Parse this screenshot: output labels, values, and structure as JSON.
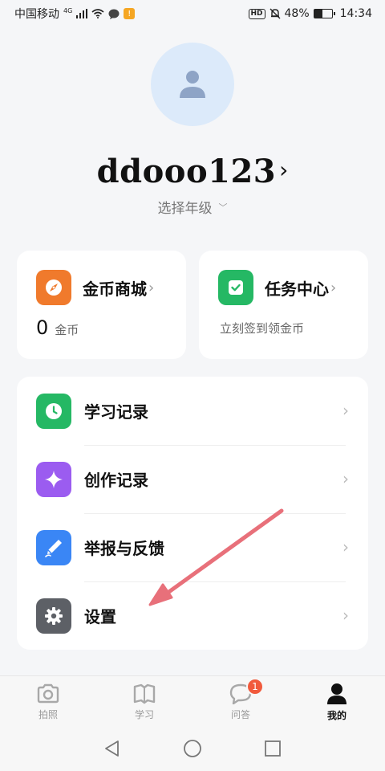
{
  "status_bar": {
    "carrier": "中国移动",
    "network": "4G",
    "battery": "48%",
    "battery_level": 0.48,
    "time": "14:34",
    "hd_label": "HD"
  },
  "profile": {
    "username": "ddooo123",
    "username_chevron": "›",
    "grade_select": "选择年级",
    "grade_chevron": "﹀"
  },
  "cards": {
    "coins": {
      "title": "金币商城",
      "chevron": "›",
      "count": "0",
      "unit": "金币",
      "icon": "compass-icon",
      "color": "#f07a2c"
    },
    "tasks": {
      "title": "任务中心",
      "chevron": "›",
      "subtitle": "立刻签到领金币",
      "icon": "check-icon",
      "color": "#25b864"
    }
  },
  "menu": {
    "items": [
      {
        "label": "学习记录",
        "icon": "clock-icon",
        "color": "#25b864",
        "chevron": "›"
      },
      {
        "label": "创作记录",
        "icon": "sparkle-icon",
        "color": "#9b5cf0",
        "chevron": "›"
      },
      {
        "label": "举报与反馈",
        "icon": "pen-icon",
        "color": "#3a86f5",
        "chevron": "›"
      },
      {
        "label": "设置",
        "icon": "gear-icon",
        "color": "#5d6066",
        "chevron": "›"
      }
    ]
  },
  "tab_bar": {
    "tabs": [
      {
        "label": "拍照",
        "icon": "camera-icon"
      },
      {
        "label": "学习",
        "icon": "book-icon"
      },
      {
        "label": "问答",
        "icon": "chat-bubble-icon",
        "badge": "1"
      },
      {
        "label": "我的",
        "icon": "person-icon",
        "active": true
      }
    ]
  }
}
